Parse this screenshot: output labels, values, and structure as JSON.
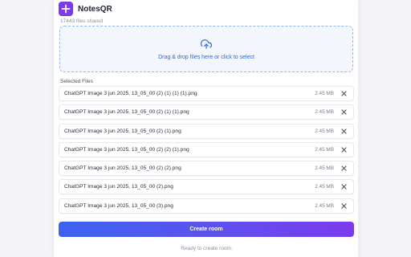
{
  "app": {
    "name": "NotesQR",
    "files_shared": "17443 files shared",
    "logo_icon": "plus-icon",
    "accent_color": "#7c3aed"
  },
  "dropzone": {
    "text": "Drag & drop files here or click to select",
    "icon": "upload-cloud-icon"
  },
  "selected_files": {
    "label": "Selected Files",
    "items": [
      {
        "name": "ChatGPT Image 3 jun 2025, 13_05_00 (2) (1) (1) (1).png",
        "size": "2.45 MB"
      },
      {
        "name": "ChatGPT Image 3 jun 2025, 13_05_00 (2) (1) (1).png",
        "size": "2.45 MB"
      },
      {
        "name": "ChatGPT Image 3 jun 2025, 13_05_00 (2) (1).png",
        "size": "2.45 MB"
      },
      {
        "name": "ChatGPT Image 3 jun 2025, 13_05_00 (2) (2) (1).png",
        "size": "2.45 MB"
      },
      {
        "name": "ChatGPT Image 3 jun 2025, 13_05_00 (2) (2).png",
        "size": "2.45 MB"
      },
      {
        "name": "ChatGPT Image 3 jun 2025, 13_05_00 (2).png",
        "size": "2.45 MB"
      },
      {
        "name": "ChatGPT Image 3 jun 2025, 13_05_00 (3).png",
        "size": "2.45 MB"
      }
    ]
  },
  "actions": {
    "create_room_label": "Create room"
  },
  "status": {
    "text": "Ready to create room."
  }
}
